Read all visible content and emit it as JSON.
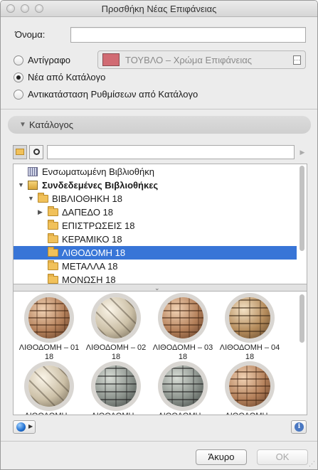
{
  "window": {
    "title": "Προσθήκη Νέας Επιφάνειας"
  },
  "form": {
    "name_label": "Όνομα:",
    "name_value": "",
    "options": [
      {
        "label": "Αντίγραφο",
        "selected": false
      },
      {
        "label": "Νέα από Κατάλογο",
        "selected": true
      },
      {
        "label": "Αντικατάσταση Ρυθμίσεων από Κατάλογο",
        "selected": false
      }
    ],
    "copy_source": {
      "text": "ΤΟΥΒΛΟ – Χρώμα Επιφάνειας",
      "swatch_color": "#d16b73"
    }
  },
  "catalog": {
    "header": "Κατάλογος",
    "search_value": "",
    "tree": [
      {
        "label": "Ενσωματωμένη Βιβλιοθήκη",
        "level": 0,
        "icon": "library-icon",
        "expand": "none",
        "bold": false,
        "selected": false
      },
      {
        "label": "Συνδεδεμένες Βιβλιοθήκες",
        "level": 0,
        "icon": "linked-libraries-icon",
        "expand": "open",
        "bold": true,
        "selected": false
      },
      {
        "label": "ΒΙΒΛΙΟΘΗΚΗ 18",
        "level": 1,
        "icon": "folder-icon",
        "expand": "open",
        "bold": false,
        "selected": false
      },
      {
        "label": "ΔΑΠΕΔΟ 18",
        "level": 2,
        "icon": "folder-icon",
        "expand": "closed",
        "bold": false,
        "selected": false
      },
      {
        "label": "ΕΠΙΣΤΡΩΣΕΙΣ 18",
        "level": 2,
        "icon": "folder-icon",
        "expand": "none",
        "bold": false,
        "selected": false
      },
      {
        "label": "ΚΕΡΑΜΙΚΟ 18",
        "level": 2,
        "icon": "folder-icon",
        "expand": "none",
        "bold": false,
        "selected": false
      },
      {
        "label": "ΛΙΘΟΔΟΜΗ 18",
        "level": 2,
        "icon": "folder-icon",
        "expand": "none",
        "bold": false,
        "selected": true
      },
      {
        "label": "ΜΕΤΑΛΛΑ 18",
        "level": 2,
        "icon": "folder-icon",
        "expand": "none",
        "bold": false,
        "selected": false
      },
      {
        "label": "ΜΟΝΩΣΗ 18",
        "level": 2,
        "icon": "folder-icon",
        "expand": "none",
        "bold": false,
        "selected": false
      }
    ],
    "thumbnails": [
      {
        "label": "ΛΙΘΟΔΟΜΗ – 01 18",
        "style": "warm"
      },
      {
        "label": "ΛΙΘΟΔΟΜΗ – 02 18",
        "style": "light"
      },
      {
        "label": "ΛΙΘΟΔΟΜΗ – 03 18",
        "style": "warm"
      },
      {
        "label": "ΛΙΘΟΔΟΜΗ – 04 18",
        "style": "base"
      },
      {
        "label": "ΛΙΘΟΔΟΜΗ – ",
        "style": "light"
      },
      {
        "label": "ΛΙΘΟΔΟΜΗ – ",
        "style": "gray"
      },
      {
        "label": "ΛΙΘΟΔΟΜΗ – ",
        "style": "gray"
      },
      {
        "label": "ΛΙΘΟΔΟΜΗ – ",
        "style": "warm"
      }
    ]
  },
  "buttons": {
    "cancel": "Άκυρο",
    "ok": "OK"
  },
  "colors": {
    "selection": "#3875d7",
    "window_bg": "#ececec"
  }
}
